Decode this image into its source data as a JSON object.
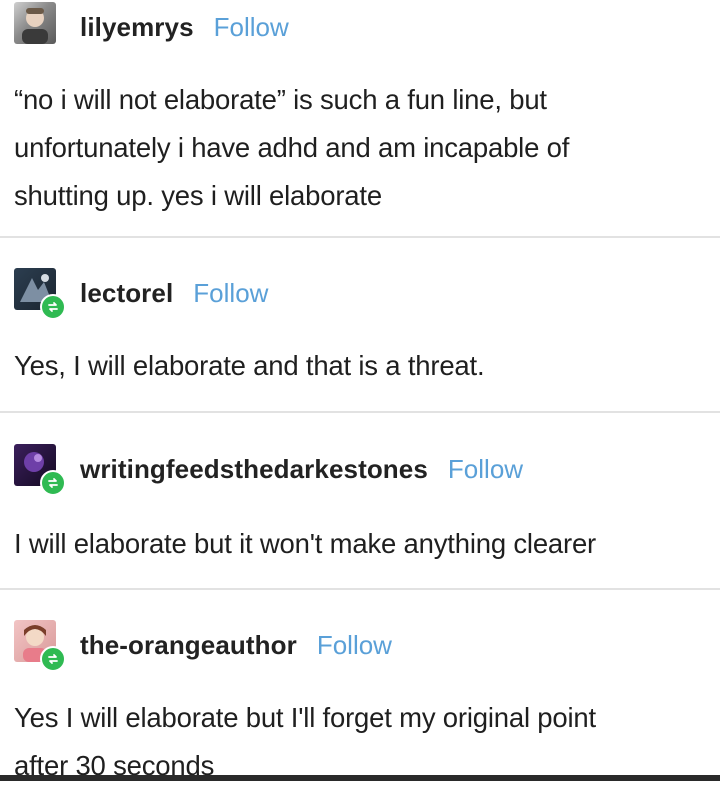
{
  "posts": [
    {
      "username": "lilyemrys",
      "follow_label": "Follow",
      "avatar_icon": "user-avatar-icon",
      "reblog": false,
      "text_lines": [
        "“no i will not elaborate” is such a fun line, but",
        "unfortunately i have adhd and am incapable of",
        "shutting up. yes i will elaborate"
      ]
    },
    {
      "username": "lectorel",
      "follow_label": "Follow",
      "avatar_icon": "user-avatar-icon",
      "reblog": true,
      "text_lines": [
        "Yes, I will elaborate and that is a threat."
      ]
    },
    {
      "username": "writingfeedsthedarkestones",
      "follow_label": "Follow",
      "avatar_icon": "user-avatar-icon",
      "reblog": true,
      "text_lines": [
        "I will elaborate but it won't make anything clearer"
      ]
    },
    {
      "username": "the-orangeauthor",
      "follow_label": "Follow",
      "avatar_icon": "user-avatar-icon",
      "reblog": true,
      "text_lines": [
        "Yes I will elaborate but I'll forget my original point",
        "after 30 seconds"
      ]
    }
  ],
  "colors": {
    "follow": "#5aa0d8",
    "reblog_badge": "#2fba52",
    "divider": "#e2e2e2",
    "text": "#1f1f1f"
  }
}
